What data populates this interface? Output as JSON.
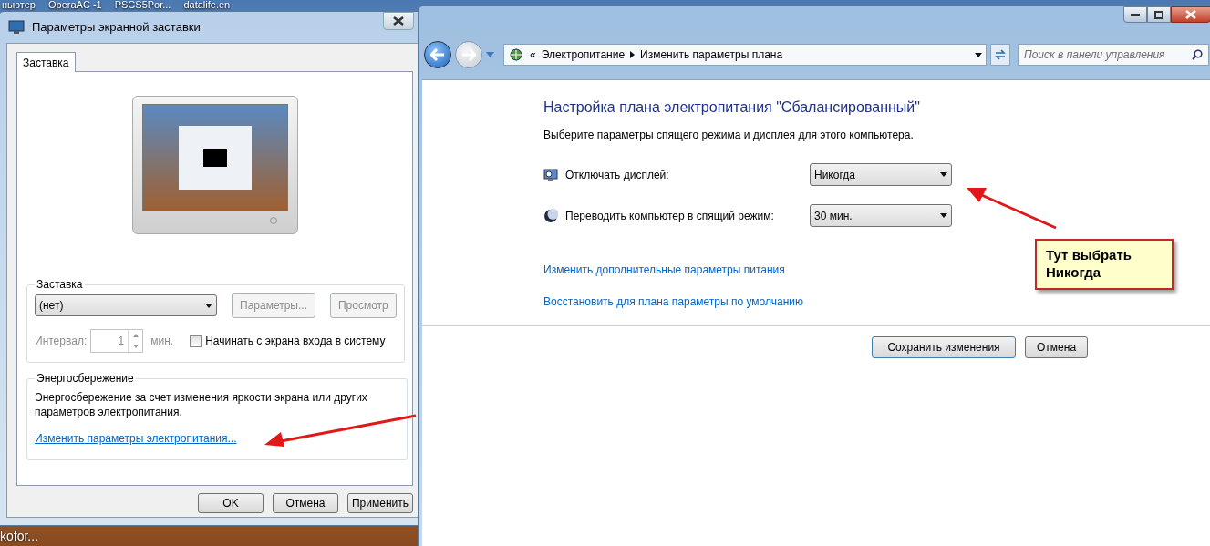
{
  "desktop": {
    "icon_labels": [
      "ньютер",
      "OperaAC -1",
      "PSCS5Por...",
      "datalife.en"
    ],
    "bottom_label": "kofor..."
  },
  "screensaver_window": {
    "title": "Параметры экранной заставки",
    "tabs": [
      {
        "label": "Заставка",
        "selected": true
      }
    ],
    "screensaver_group": {
      "title": "Заставка",
      "dropdown": {
        "value": "(нет)"
      },
      "buttons": [
        {
          "label": "Параметры...",
          "disabled": true
        },
        {
          "label": "Просмотр",
          "disabled": true
        }
      ],
      "interval": {
        "label": "Интервал:",
        "value": "1",
        "unit": "мин.",
        "disabled": true
      },
      "checkbox": {
        "label": "Начинать с экрана входа в систему",
        "checked": false
      }
    },
    "power_group": {
      "title": "Энергосбережение",
      "description": "Энергосбережение за счет изменения яркости экрана или других параметров электропитания.",
      "link": "Изменить параметры электропитания..."
    },
    "buttons": [
      {
        "label": "OK"
      },
      {
        "label": "Отмена"
      },
      {
        "label": "Применить"
      }
    ]
  },
  "power_window": {
    "breadcrumb_prefix": "«",
    "breadcrumb": [
      "Электропитание",
      "Изменить параметры плана"
    ],
    "search": {
      "placeholder": "Поиск в панели управления"
    },
    "heading": "Настройка плана электропитания \"Сбалансированный\"",
    "subtitle": "Выберите параметры спящего режима и дисплея для этого компьютера.",
    "settings": [
      {
        "kind": "display",
        "label": "Отключать дисплей:",
        "value": "Никогда"
      },
      {
        "kind": "sleep",
        "label": "Переводить компьютер в спящий режим:",
        "value": "30 мин."
      }
    ],
    "links": [
      "Изменить дополнительные параметры питания",
      "Восстановить для плана параметры по умолчанию"
    ],
    "buttons": [
      {
        "label": "Сохранить изменения"
      },
      {
        "label": "Отмена"
      }
    ]
  },
  "annotation": {
    "callout": "Тут выбрать Никогда"
  }
}
